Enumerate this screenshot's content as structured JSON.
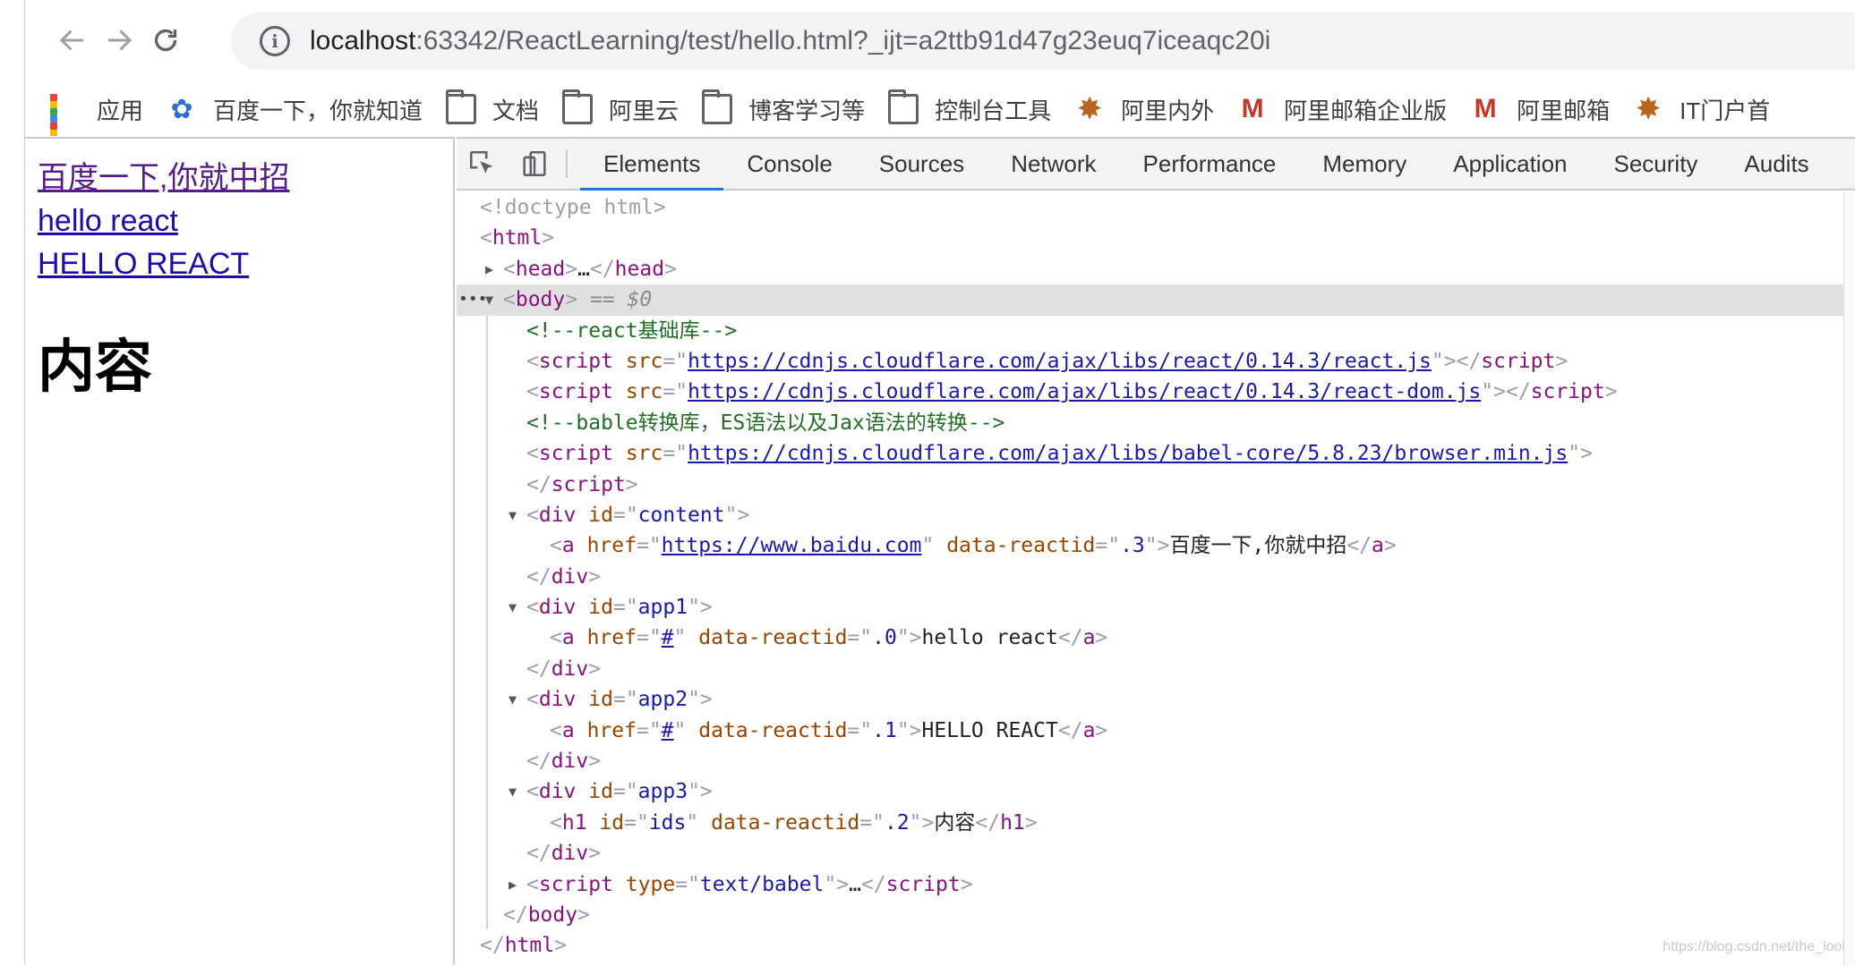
{
  "browser": {
    "url_host": "localhost",
    "url_path": ":63342/ReactLearning/test/hello.html?_ijt=a2ttb91d47g23euq7iceaqc20i",
    "back_label": "←",
    "forward_label": "→",
    "reload_label": "⟳",
    "info_label": "i"
  },
  "bookmarks": [
    {
      "label": "应用",
      "icon": "apps-grid-icon"
    },
    {
      "label": "百度一下，你就知道",
      "icon": "baidu-paw-icon"
    },
    {
      "label": "文档",
      "icon": "folder-icon"
    },
    {
      "label": "阿里云",
      "icon": "folder-icon"
    },
    {
      "label": "博客学习等",
      "icon": "folder-icon"
    },
    {
      "label": "控制台工具",
      "icon": "folder-icon"
    },
    {
      "label": "阿里内外",
      "icon": "alibaba-star-icon"
    },
    {
      "label": "阿里邮箱企业版",
      "icon": "alimail-m-icon"
    },
    {
      "label": "阿里邮箱",
      "icon": "alimail-m-icon"
    },
    {
      "label": "IT门户首",
      "icon": "alibaba-star-icon"
    }
  ],
  "page": {
    "link1": "百度一下,你就中招",
    "link2": "hello react",
    "link3": "HELLO REACT",
    "heading": "内容"
  },
  "devtools": {
    "tabs": [
      "Elements",
      "Console",
      "Sources",
      "Network",
      "Performance",
      "Memory",
      "Application",
      "Security",
      "Audits"
    ],
    "active_tab": "Elements",
    "dom": {
      "doctype": "<!doctype html>",
      "html_open": "html",
      "head_tag": "head",
      "head_ellipsis": "…",
      "body_tag": "body",
      "body_marker": " == $0",
      "comment1": "<!--react基础库-->",
      "script_src_1": "https://cdnjs.cloudflare.com/ajax/libs/react/0.14.3/react.js",
      "script_src_2": "https://cdnjs.cloudflare.com/ajax/libs/react/0.14.3/react-dom.js",
      "comment2": "<!--bable转换库，ES语法以及Jax语法的转换-->",
      "script_src_3": "https://cdnjs.cloudflare.com/ajax/libs/babel-core/5.8.23/browser.min.js",
      "div_content_id": "content",
      "a1_href": "https://www.baidu.com",
      "a1_reactid": ".3",
      "a1_text": "百度一下,你就中招",
      "div_app1_id": "app1",
      "a2_href": "#",
      "a2_reactid": ".0",
      "a2_text": "hello react",
      "div_app2_id": "app2",
      "a3_href": "#",
      "a3_reactid": ".1",
      "a3_text": "HELLO REACT",
      "div_app3_id": "app3",
      "h1_id": "ids",
      "h1_reactid": ".2",
      "h1_text": "内容",
      "script_type": "text/babel",
      "script_ellipsis": "…"
    }
  },
  "watermark": "https://blog.csdn.net/the_lool"
}
